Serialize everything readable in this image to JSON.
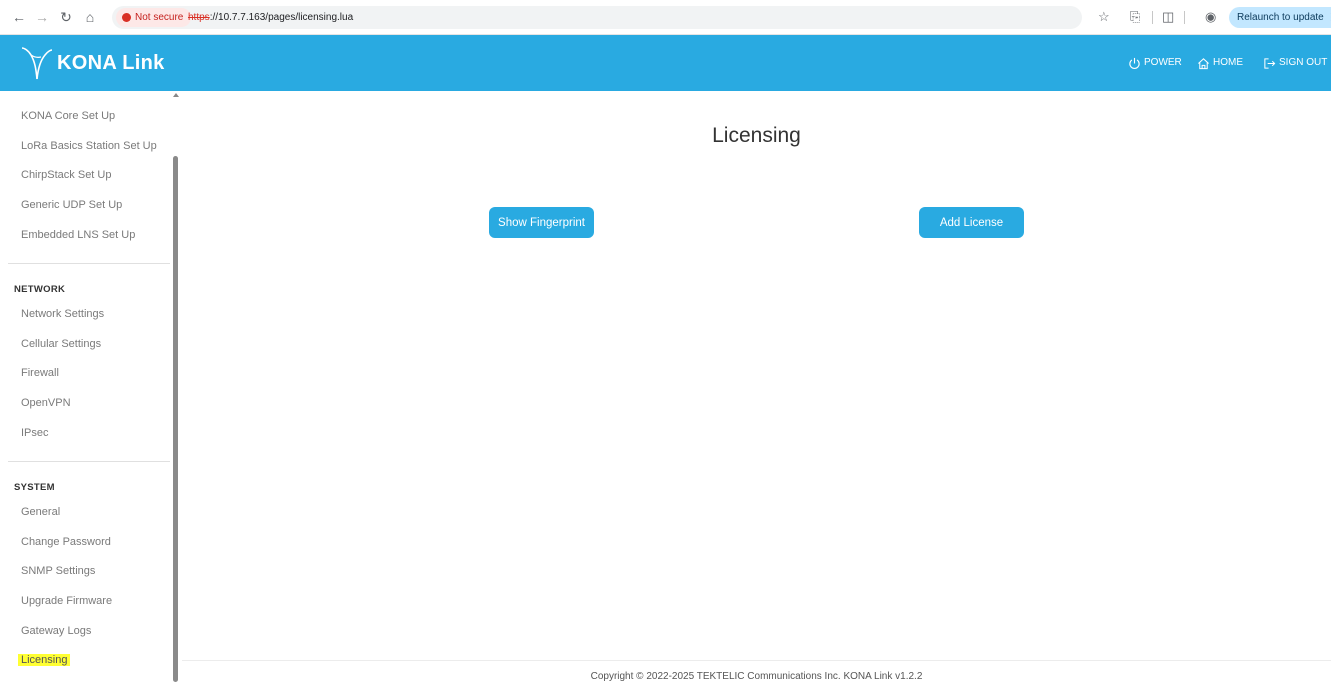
{
  "browser": {
    "security_label": "Not secure",
    "url_scheme": "https",
    "url_rest": "://10.7.7.163/pages/licensing.lua",
    "relaunch_label": "Relaunch to update"
  },
  "header": {
    "brand": "KONA Link",
    "nav": [
      {
        "label": "POWER",
        "icon": "power-icon"
      },
      {
        "label": "HOME",
        "icon": "home-icon"
      },
      {
        "label": "SIGN OUT",
        "icon": "sign-out-icon"
      }
    ]
  },
  "sidebar": {
    "top_items": [
      "KONA Core Set Up",
      "LoRa Basics Station Set Up",
      "ChirpStack Set Up",
      "Generic UDP Set Up",
      "Embedded LNS Set Up"
    ],
    "network_heading": "NETWORK",
    "network_items": [
      "Network Settings",
      "Cellular Settings",
      "Firewall",
      "OpenVPN",
      "IPsec"
    ],
    "system_heading": "SYSTEM",
    "system_items": [
      "General",
      "Change Password",
      "SNMP Settings",
      "Upgrade Firmware",
      "Gateway Logs",
      "Licensing"
    ],
    "active_item": "Licensing"
  },
  "main": {
    "title": "Licensing",
    "show_fingerprint_label": "Show Fingerprint",
    "add_license_label": "Add License"
  },
  "footer": {
    "copyright": "Copyright © 2022-2025 TEKTELIC Communications Inc. KONA Link v1.2.2"
  },
  "colors": {
    "header_bg": "#29aae1",
    "button_bg": "#29aae1",
    "active_highlight": "#ffff33"
  }
}
